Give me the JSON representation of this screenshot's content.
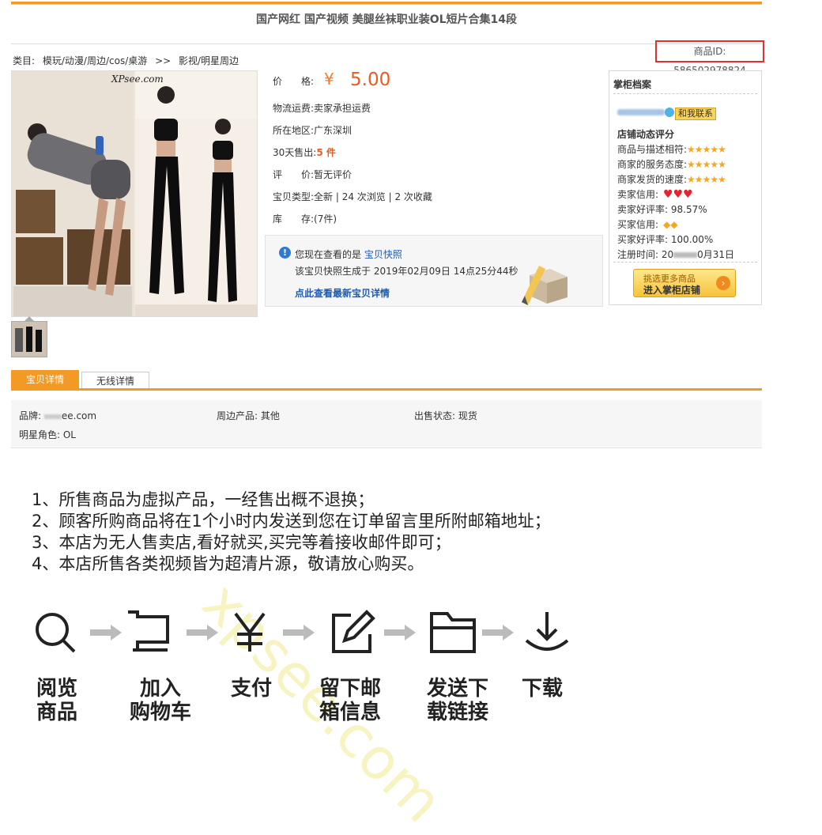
{
  "page_title": "国产网红 国产视频 美腿丝袜职业装OL短片合集14段",
  "breadcrumb": {
    "prefix": "类目:",
    "cat1": "模玩/动漫/周边/cos/桌游",
    "sep": ">>",
    "cat2": "影视/明星周边"
  },
  "product_id": "商品ID: 586502978824",
  "image_watermark": "XPsee.com",
  "price": {
    "label": "价　　格:",
    "symbol": "¥",
    "value": "5.00"
  },
  "shipping": {
    "label": "物流运费:",
    "value": "卖家承担运费"
  },
  "location": {
    "label": "所在地区:",
    "value": "广东深圳"
  },
  "sales": {
    "label": "30天售出:",
    "value": "5 件"
  },
  "rating": {
    "label": "评　　价:",
    "value": "暂无评价"
  },
  "item_type": {
    "label": "宝贝类型:",
    "value": "全新 | 24 次浏览 | 2 次收藏"
  },
  "stock": {
    "label": "库　　存:",
    "value": "(7件)"
  },
  "snapshot": {
    "line1_prefix": "您现在查看的是",
    "line1_link": "宝贝快照",
    "line2": "该宝贝快照生成于 2019年02月09日 14点25分44秒",
    "link": "点此查看最新宝贝详情"
  },
  "shop": {
    "title": "掌柜档案",
    "contact": "和我联系",
    "dsr_title": "店铺动态评分",
    "dsr": [
      {
        "label": "商品与描述相符:"
      },
      {
        "label": "商家的服务态度:"
      },
      {
        "label": "商家发货的速度:"
      }
    ],
    "seller_credit": "卖家信用:",
    "seller_rate": "卖家好评率: 98.57%",
    "buyer_credit": "买家信用:",
    "buyer_rate": "买家好评率: 100.00%",
    "register_prefix": "注册时间: 20",
    "register_suffix": "0月31日",
    "btn_line1": "挑选更多商品",
    "btn_line2": "进入掌柜店铺",
    "star_color": "#f5a623",
    "heart_color": "#e8222d",
    "diamond_color": "#f5a623"
  },
  "tabs": [
    {
      "label": "宝贝详情"
    },
    {
      "label": "无线详情"
    }
  ],
  "attributes": {
    "brand": "品牌: ",
    "brand_value": "ee.com",
    "peripheral": "周边产品: 其他",
    "status": "出售状态: 现货",
    "role": "明星角色: OL"
  },
  "notices": [
    "1、所售商品为虚拟产品，一经售出概不退换；",
    "2、顾客所购商品将在1个小时内发送到您在订单留言里所附邮箱地址；",
    "3、本店为无人售卖店,看好就买,买完等着接收邮件即可；",
    "4、本店所售各类视频皆为超清片源，敬请放心购买。"
  ],
  "steps": [
    {
      "line1": "阅览",
      "line2": "商品",
      "icon": "search-icon"
    },
    {
      "line1": "加入",
      "line2": "购物车",
      "icon": "cart-icon"
    },
    {
      "line1": "支付",
      "line2": "",
      "icon": "yen-icon"
    },
    {
      "line1": "留下邮",
      "line2": "箱信息",
      "icon": "edit-icon"
    },
    {
      "line1": "发送下",
      "line2": "载链接",
      "icon": "folder-icon"
    },
    {
      "line1": "下载",
      "line2": "",
      "icon": "download-icon"
    }
  ],
  "bg_watermark": "xpsee.com",
  "colors": {
    "accent": "#f39a26",
    "price": "#f05a1a",
    "link": "#1a5ab5",
    "highlight_box": "#e03030"
  }
}
